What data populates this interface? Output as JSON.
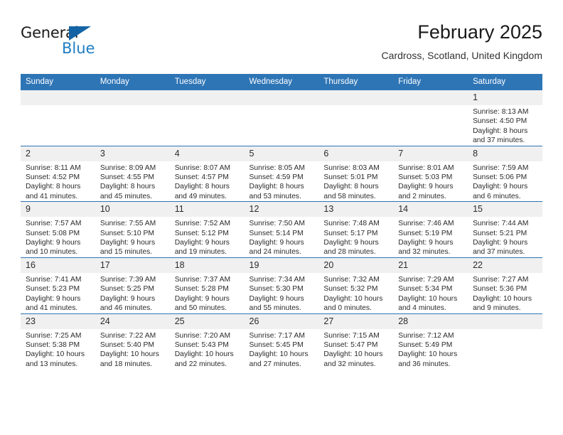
{
  "brand": {
    "name_dark": "General",
    "name_light": "Blue",
    "triangle_color": "#1464a5",
    "accent_color": "#1f7ec4"
  },
  "header": {
    "month_title": "February 2025",
    "location": "Cardross, Scotland, United Kingdom"
  },
  "theme": {
    "header_row_bg": "#2e75b6",
    "daynum_bg": "#f0f0f0",
    "row_divider": "#2e75b6",
    "text": "#2b2b2b"
  },
  "calendar": {
    "weekday_headers": [
      "Sunday",
      "Monday",
      "Tuesday",
      "Wednesday",
      "Thursday",
      "Friday",
      "Saturday"
    ],
    "weeks": [
      [
        {
          "day": "",
          "empty": true
        },
        {
          "day": "",
          "empty": true
        },
        {
          "day": "",
          "empty": true
        },
        {
          "day": "",
          "empty": true
        },
        {
          "day": "",
          "empty": true
        },
        {
          "day": "",
          "empty": true
        },
        {
          "day": "1",
          "sunrise": "Sunrise: 8:13 AM",
          "sunset": "Sunset: 4:50 PM",
          "daylight": "Daylight: 8 hours and 37 minutes."
        }
      ],
      [
        {
          "day": "2",
          "sunrise": "Sunrise: 8:11 AM",
          "sunset": "Sunset: 4:52 PM",
          "daylight": "Daylight: 8 hours and 41 minutes."
        },
        {
          "day": "3",
          "sunrise": "Sunrise: 8:09 AM",
          "sunset": "Sunset: 4:55 PM",
          "daylight": "Daylight: 8 hours and 45 minutes."
        },
        {
          "day": "4",
          "sunrise": "Sunrise: 8:07 AM",
          "sunset": "Sunset: 4:57 PM",
          "daylight": "Daylight: 8 hours and 49 minutes."
        },
        {
          "day": "5",
          "sunrise": "Sunrise: 8:05 AM",
          "sunset": "Sunset: 4:59 PM",
          "daylight": "Daylight: 8 hours and 53 minutes."
        },
        {
          "day": "6",
          "sunrise": "Sunrise: 8:03 AM",
          "sunset": "Sunset: 5:01 PM",
          "daylight": "Daylight: 8 hours and 58 minutes."
        },
        {
          "day": "7",
          "sunrise": "Sunrise: 8:01 AM",
          "sunset": "Sunset: 5:03 PM",
          "daylight": "Daylight: 9 hours and 2 minutes."
        },
        {
          "day": "8",
          "sunrise": "Sunrise: 7:59 AM",
          "sunset": "Sunset: 5:06 PM",
          "daylight": "Daylight: 9 hours and 6 minutes."
        }
      ],
      [
        {
          "day": "9",
          "sunrise": "Sunrise: 7:57 AM",
          "sunset": "Sunset: 5:08 PM",
          "daylight": "Daylight: 9 hours and 10 minutes."
        },
        {
          "day": "10",
          "sunrise": "Sunrise: 7:55 AM",
          "sunset": "Sunset: 5:10 PM",
          "daylight": "Daylight: 9 hours and 15 minutes."
        },
        {
          "day": "11",
          "sunrise": "Sunrise: 7:52 AM",
          "sunset": "Sunset: 5:12 PM",
          "daylight": "Daylight: 9 hours and 19 minutes."
        },
        {
          "day": "12",
          "sunrise": "Sunrise: 7:50 AM",
          "sunset": "Sunset: 5:14 PM",
          "daylight": "Daylight: 9 hours and 24 minutes."
        },
        {
          "day": "13",
          "sunrise": "Sunrise: 7:48 AM",
          "sunset": "Sunset: 5:17 PM",
          "daylight": "Daylight: 9 hours and 28 minutes."
        },
        {
          "day": "14",
          "sunrise": "Sunrise: 7:46 AM",
          "sunset": "Sunset: 5:19 PM",
          "daylight": "Daylight: 9 hours and 32 minutes."
        },
        {
          "day": "15",
          "sunrise": "Sunrise: 7:44 AM",
          "sunset": "Sunset: 5:21 PM",
          "daylight": "Daylight: 9 hours and 37 minutes."
        }
      ],
      [
        {
          "day": "16",
          "sunrise": "Sunrise: 7:41 AM",
          "sunset": "Sunset: 5:23 PM",
          "daylight": "Daylight: 9 hours and 41 minutes."
        },
        {
          "day": "17",
          "sunrise": "Sunrise: 7:39 AM",
          "sunset": "Sunset: 5:25 PM",
          "daylight": "Daylight: 9 hours and 46 minutes."
        },
        {
          "day": "18",
          "sunrise": "Sunrise: 7:37 AM",
          "sunset": "Sunset: 5:28 PM",
          "daylight": "Daylight: 9 hours and 50 minutes."
        },
        {
          "day": "19",
          "sunrise": "Sunrise: 7:34 AM",
          "sunset": "Sunset: 5:30 PM",
          "daylight": "Daylight: 9 hours and 55 minutes."
        },
        {
          "day": "20",
          "sunrise": "Sunrise: 7:32 AM",
          "sunset": "Sunset: 5:32 PM",
          "daylight": "Daylight: 10 hours and 0 minutes."
        },
        {
          "day": "21",
          "sunrise": "Sunrise: 7:29 AM",
          "sunset": "Sunset: 5:34 PM",
          "daylight": "Daylight: 10 hours and 4 minutes."
        },
        {
          "day": "22",
          "sunrise": "Sunrise: 7:27 AM",
          "sunset": "Sunset: 5:36 PM",
          "daylight": "Daylight: 10 hours and 9 minutes."
        }
      ],
      [
        {
          "day": "23",
          "sunrise": "Sunrise: 7:25 AM",
          "sunset": "Sunset: 5:38 PM",
          "daylight": "Daylight: 10 hours and 13 minutes."
        },
        {
          "day": "24",
          "sunrise": "Sunrise: 7:22 AM",
          "sunset": "Sunset: 5:40 PM",
          "daylight": "Daylight: 10 hours and 18 minutes."
        },
        {
          "day": "25",
          "sunrise": "Sunrise: 7:20 AM",
          "sunset": "Sunset: 5:43 PM",
          "daylight": "Daylight: 10 hours and 22 minutes."
        },
        {
          "day": "26",
          "sunrise": "Sunrise: 7:17 AM",
          "sunset": "Sunset: 5:45 PM",
          "daylight": "Daylight: 10 hours and 27 minutes."
        },
        {
          "day": "27",
          "sunrise": "Sunrise: 7:15 AM",
          "sunset": "Sunset: 5:47 PM",
          "daylight": "Daylight: 10 hours and 32 minutes."
        },
        {
          "day": "28",
          "sunrise": "Sunrise: 7:12 AM",
          "sunset": "Sunset: 5:49 PM",
          "daylight": "Daylight: 10 hours and 36 minutes."
        },
        {
          "day": "",
          "empty": true
        }
      ]
    ]
  }
}
